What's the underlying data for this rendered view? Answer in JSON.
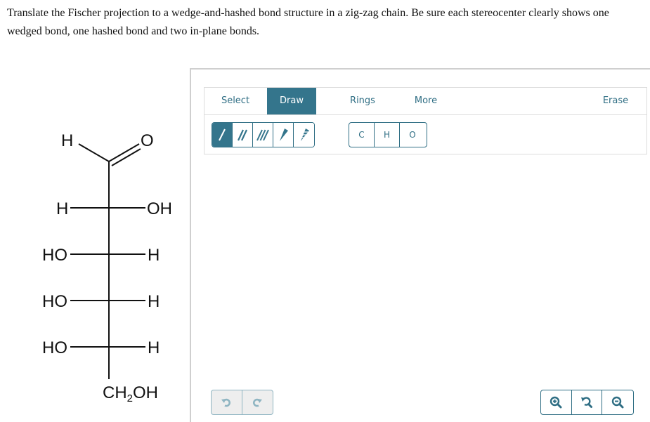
{
  "question": {
    "text": "Translate the Fischer projection to a wedge-and-hashed bond structure in a zig-zag chain. Be sure each stereocenter clearly shows one wedged bond, one hashed bond and two in-plane bonds."
  },
  "fischer": {
    "top_group": {
      "h_label": "H",
      "o_label": "O"
    },
    "rows": [
      {
        "left": "H",
        "right": "OH"
      },
      {
        "left": "HO",
        "right": "H"
      },
      {
        "left": "HO",
        "right": "H"
      },
      {
        "left": "HO",
        "right": "H"
      }
    ],
    "bottom_group": {
      "prefix": "CH",
      "subscript": "2",
      "suffix": "OH"
    }
  },
  "toolbar": {
    "tabs": [
      {
        "label": "Select",
        "active": false
      },
      {
        "label": "Draw",
        "active": true
      },
      {
        "label": "Rings",
        "active": false
      },
      {
        "label": "More",
        "active": false
      },
      {
        "label": "Erase",
        "active": false
      }
    ],
    "bond_tools": [
      {
        "icon": "single-bond-icon",
        "active": true
      },
      {
        "icon": "double-bond-icon",
        "active": false
      },
      {
        "icon": "triple-bond-icon",
        "active": false
      },
      {
        "icon": "wedge-bond-icon",
        "active": false
      },
      {
        "icon": "hashed-wedge-bond-icon",
        "active": false
      }
    ],
    "atoms": [
      "C",
      "H",
      "O"
    ]
  },
  "history": {
    "undo_icon": "undo-icon",
    "redo_icon": "redo-icon"
  },
  "zoom_controls": {
    "zoom_in_icon": "zoom-in-icon",
    "reset_icon": "zoom-reset-icon",
    "zoom_out_icon": "zoom-out-icon"
  },
  "colors": {
    "accent": "#34758c",
    "accent_text": "#2f6e84",
    "disabled": "#8fb5c2"
  }
}
